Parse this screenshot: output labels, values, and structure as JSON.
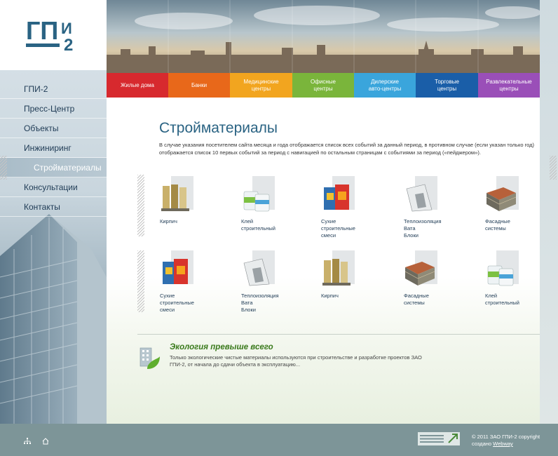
{
  "logo": {
    "line1": "ГП",
    "line2": "И",
    "line3": "2"
  },
  "sidebar": {
    "items": [
      {
        "label": "ГПИ-2"
      },
      {
        "label": "Пресс-Центр"
      },
      {
        "label": "Объекты"
      },
      {
        "label": "Инжиниринг"
      },
      {
        "label": "Стройматериалы",
        "active": true
      },
      {
        "label": "Консультации"
      },
      {
        "label": "Контакты"
      }
    ]
  },
  "nav": {
    "tabs": [
      {
        "label": "Жилые дома",
        "color": "#d7292e"
      },
      {
        "label": "Банки",
        "color": "#e8681a"
      },
      {
        "label": "Медицинские\nцентры",
        "color": "#f2a51f"
      },
      {
        "label": "Офисные\nцентры",
        "color": "#7ab53b"
      },
      {
        "label": "Дилерские\nавто-центры",
        "color": "#3aa5dc"
      },
      {
        "label": "Торговые\nцентры",
        "color": "#1a5ea8"
      },
      {
        "label": "Развлекательные\nцентры",
        "color": "#9a4fb8"
      }
    ]
  },
  "main": {
    "title": "Стройматериалы",
    "intro": "В случае указания посетителем сайта месяца и года отображается список всех событий за данный период, в противном случае (если указан только год) отображается список 10 первых событий за период с навигацией по остальным страницам с событиями за период («пейджером»).",
    "row1": [
      {
        "label": "Кирпич",
        "icon": "rolls-icon"
      },
      {
        "label": "Клей\nстроительный",
        "icon": "buckets-icon"
      },
      {
        "label": "Сухие\nстроительные\nсмеси",
        "icon": "bags-icon"
      },
      {
        "label": "Теплоизоляция\nВата\nБлоки",
        "icon": "insulation-icon"
      },
      {
        "label": "Фасадные\nсистемы",
        "icon": "bricks-icon"
      }
    ],
    "row2": [
      {
        "label": "Сухие\nстроительные\nсмеси",
        "icon": "bags-icon"
      },
      {
        "label": "Теплоизоляция\nВата\nБлоки",
        "icon": "insulation-icon"
      },
      {
        "label": "Кирпич",
        "icon": "rolls-icon"
      },
      {
        "label": "Фасадные\nсистемы",
        "icon": "bricks-icon"
      },
      {
        "label": "Клей\nстроительный",
        "icon": "buckets-icon"
      }
    ]
  },
  "eco": {
    "title": "Экология превыше всего",
    "text": "Только экологические чистые материалы используются при строительстве и разработке проектов ЗАО ГПИ-2, от начала до сдачи объекта в эксплуатацию..."
  },
  "footer": {
    "copyright": "© 2011 ЗАО ГПИ-2 copyright",
    "made_by_prefix": "создано",
    "made_by_link": "Webway"
  },
  "colors": {
    "accent": "#2a6383",
    "footer": "#7d9598"
  }
}
